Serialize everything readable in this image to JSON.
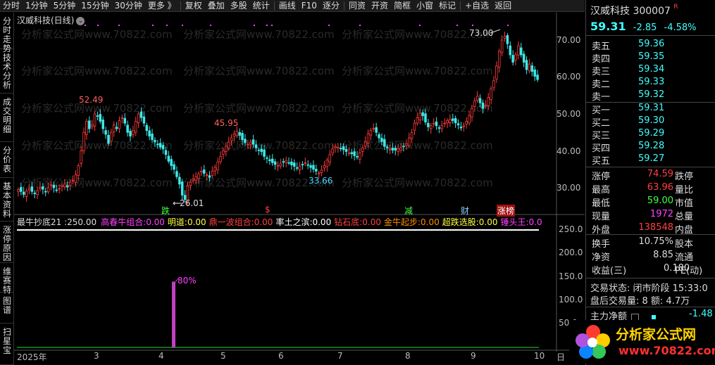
{
  "toolbar": {
    "items": [
      "分时",
      "1分钟",
      "5分钟",
      "15分钟",
      "30分钟",
      "更多 》",
      "复权",
      "叠加",
      "多股",
      "统计",
      "画线",
      "F10",
      "逐分",
      "同资",
      "开资",
      "简框",
      "小窗",
      "标记",
      "+自选",
      "返回"
    ]
  },
  "sidebar": {
    "items": [
      "分时走势",
      "技术分析",
      "成交明细",
      "分价表",
      "基本资料",
      "涨停原因",
      "维赛特",
      "图谱",
      "扫星宝"
    ]
  },
  "chart_title": "汉威科技(日线)",
  "watermark": "分析家公式网www.70822.com",
  "chart_data": {
    "type": "candlestick",
    "x_ticks": [
      "2025年",
      "3",
      "4",
      "5",
      "6",
      "7",
      "8",
      "9",
      "10"
    ],
    "y_ticks": [
      "70.00",
      "60.00",
      "50.00",
      "40.00",
      "30.00"
    ],
    "ylim": [
      25,
      78
    ],
    "annotations": [
      {
        "text": "52.49"
      },
      {
        "text": "45.95"
      },
      {
        "text": "33.66"
      },
      {
        "text": "73.00"
      },
      {
        "text": "←26.01"
      }
    ],
    "closes": [
      29.5,
      29,
      28.2,
      29.1,
      29.8,
      29,
      28.5,
      29.2,
      30.1,
      29.6,
      29,
      30,
      30.8,
      30,
      29.4,
      29.8,
      30.6,
      31,
      30.2,
      31.5,
      32,
      33.5,
      36,
      40,
      45,
      48,
      46,
      47,
      50,
      49.5,
      48,
      46,
      44.5,
      42,
      45,
      47,
      46,
      48.2,
      49,
      47.5,
      45,
      44,
      45.5,
      48,
      50,
      49,
      47.5,
      45.5,
      44,
      43,
      42.4,
      41.8,
      41,
      40.5,
      39,
      37.2,
      36,
      35,
      33,
      31,
      28,
      26.8,
      30.5,
      31.5,
      32.4,
      33,
      33.8,
      34.5,
      33.9,
      33.5,
      32.8,
      34.5,
      35.5,
      37,
      38.5,
      40,
      41.2,
      42.4,
      43.5,
      44.6,
      45.3,
      44.2,
      43,
      42.2,
      41.8,
      42.4,
      41.8,
      40.8,
      40.2,
      39.8,
      38.5,
      38,
      37.3,
      36.8,
      36.3,
      36,
      36.5,
      36.9,
      37.4,
      36.8,
      36.2,
      35.8,
      35.3,
      35.9,
      36.3,
      36.8,
      36.2,
      35.5,
      35,
      34.5,
      34,
      34.8,
      36,
      37.5,
      39,
      40.5,
      41.2,
      41,
      40.6,
      40.3,
      39.8,
      39.5,
      39.2,
      38.7,
      38.3,
      39.5,
      40.8,
      42.5,
      44.6,
      45.5,
      46.1,
      45,
      43.5,
      42.5,
      41.2,
      40.8,
      40.5,
      40.2,
      40.2,
      40.6,
      40.8,
      41.2,
      42,
      43.5,
      45,
      47.5,
      49,
      50.2,
      49.5,
      47.8,
      46.5,
      46.8,
      47.5,
      46.8,
      46.2,
      46.8,
      47.5,
      48.2,
      48.6,
      48.2,
      47.6,
      47,
      46.2,
      46.8,
      48,
      49.5,
      51.5,
      53.5,
      54.8,
      53,
      51.5,
      52.4,
      54.5,
      56.8,
      59,
      63,
      67,
      70,
      71,
      69,
      66,
      64,
      66,
      68.5,
      66,
      64,
      62,
      63.5,
      61.5,
      60.2,
      59.31
    ]
  },
  "indicator": {
    "name": "最牛抄底21 :",
    "value": "250.00",
    "params": [
      {
        "label": "高春牛组合:",
        "value": "0.00",
        "color": "#ff40ff"
      },
      {
        "label": "明道:",
        "value": "0.00",
        "color": "#ffff40"
      },
      {
        "label": "鼎一波组合:",
        "value": "0.00",
        "color": "#ff4040"
      },
      {
        "label": "率土之滨:",
        "value": "0.00",
        "color": "#ffffff"
      },
      {
        "label": "钻石底:",
        "value": "0.00",
        "color": "#ff4040"
      },
      {
        "label": "金牛起步:",
        "value": "0.00",
        "color": "#ff8c00"
      },
      {
        "label": "超跌选股:",
        "value": "0.00",
        "color": "#ffff40"
      },
      {
        "label": "锤头王:",
        "value": "0.0",
        "color": "#ff40ff"
      }
    ],
    "y_ticks": [
      "250.0",
      "200.0",
      "150.0",
      "100.0",
      "50.0"
    ],
    "bar_label": "80%",
    "bar_value": 140
  },
  "markers": {
    "die": "跌",
    "s": "$",
    "jian": "减",
    "cai": "财",
    "zhangting": "涨榜"
  },
  "stock": {
    "name": "汉威科技",
    "code": "300007",
    "flag": "R",
    "price": "59.31",
    "change": "-2.85",
    "pct": "-4.58%"
  },
  "orderbook": {
    "asks": [
      {
        "label": "卖五",
        "price": "59.36"
      },
      {
        "label": "卖四",
        "price": "59.35"
      },
      {
        "label": "卖三",
        "price": "59.34"
      },
      {
        "label": "卖二",
        "price": "59.33"
      },
      {
        "label": "卖一",
        "price": "59.32"
      }
    ],
    "bids": [
      {
        "label": "买一",
        "price": "59.31"
      },
      {
        "label": "买二",
        "price": "59.30"
      },
      {
        "label": "买三",
        "price": "59.29"
      },
      {
        "label": "买四",
        "price": "59.28"
      },
      {
        "label": "买五",
        "price": "59.27"
      }
    ]
  },
  "stats": [
    {
      "label": "涨停",
      "value": "74.59",
      "color": "#ff4040",
      "label2": "跌停"
    },
    {
      "label": "最高",
      "value": "63.96",
      "color": "#ff4040",
      "label2": "量比"
    },
    {
      "label": "最低",
      "value": "59.00",
      "color": "#40ff40",
      "label2": "市值"
    },
    {
      "label": "现量",
      "value": "1972",
      "color": "#ff40ff",
      "label2": "总量"
    },
    {
      "label": "外盘",
      "value": "138548",
      "color": "#ff4040",
      "label2": "内盘"
    },
    {
      "label": "换手",
      "value": "10.75%",
      "color": "#dddddd",
      "label2": "股本"
    },
    {
      "label": "净资",
      "value": "8.85",
      "color": "#dddddd",
      "label2": "流通"
    },
    {
      "label": "收益(三)",
      "value": "0.180",
      "color": "#dddddd",
      "label2": "PE(动)"
    }
  ],
  "trade_status": "交易状态: 闭市阶段 15:33:0",
  "after_hours": "盘后交易量: 8  额: 4.7万",
  "main_flow_label": "主力净额",
  "main_flow_value": "-1.48",
  "logo": {
    "text": "分析家公式网",
    "url": "www.70822.com"
  },
  "day_label": "日"
}
